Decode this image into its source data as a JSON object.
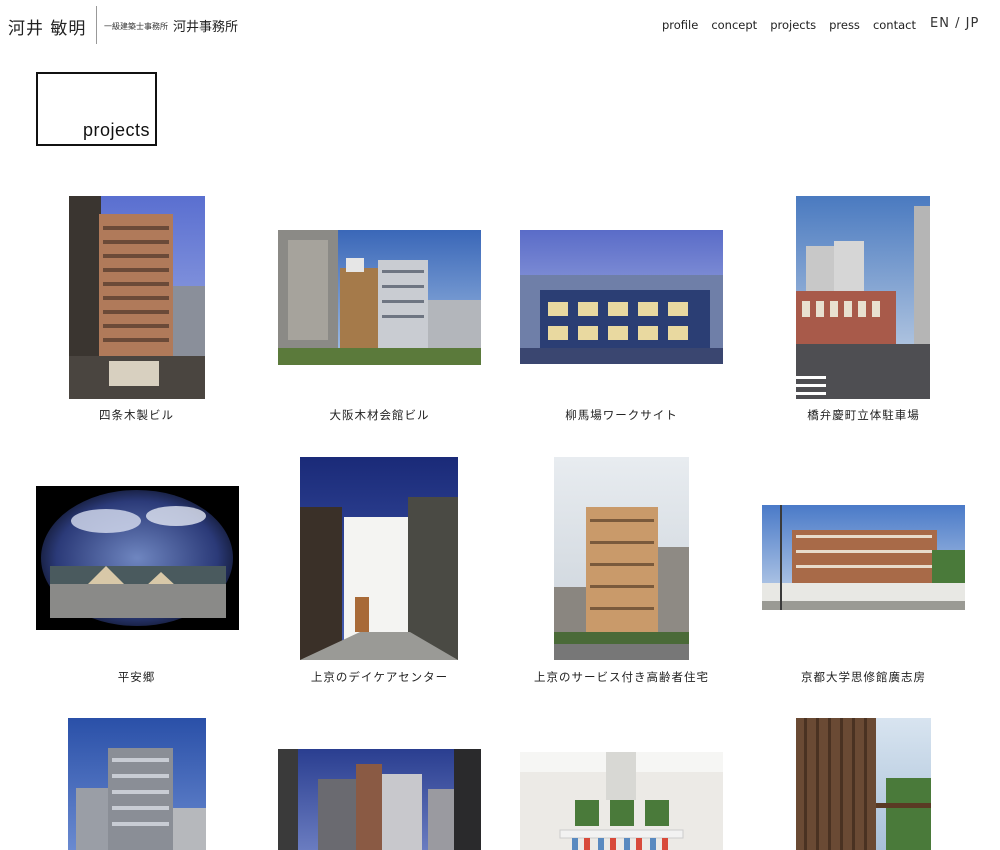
{
  "header": {
    "site_name": "河井 敏明",
    "office_small": "一級建築士事務所",
    "office_name": "河井事務所",
    "nav": [
      "profile",
      "concept",
      "projects",
      "press",
      "contact"
    ],
    "lang": {
      "en": "EN",
      "sep": "/",
      "jp": "JP"
    }
  },
  "section": {
    "title": "projects"
  },
  "projects": [
    {
      "caption": "四条木製ビル"
    },
    {
      "caption": "大阪木材会館ビル"
    },
    {
      "caption": "柳馬場ワークサイト"
    },
    {
      "caption": "橋弁慶町立体駐車場"
    },
    {
      "caption": "平安郷"
    },
    {
      "caption": "上京のデイケアセンター"
    },
    {
      "caption": "上京のサービス付き高齢者住宅"
    },
    {
      "caption": "京都大学思修館廣志房"
    },
    {
      "caption": ""
    },
    {
      "caption": ""
    },
    {
      "caption": ""
    },
    {
      "caption": ""
    }
  ]
}
